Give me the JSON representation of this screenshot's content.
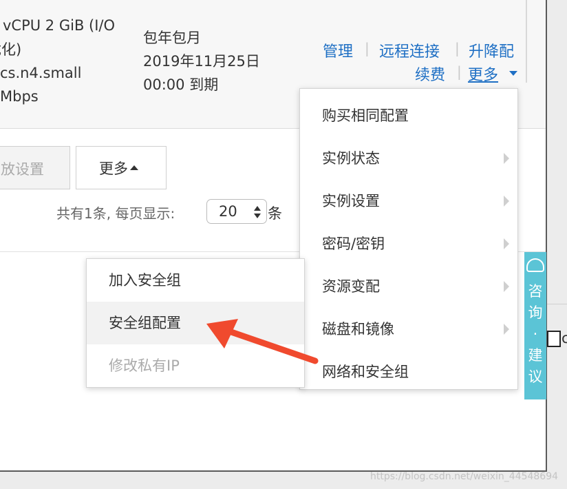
{
  "instance": {
    "spec_lines": [
      "vCPU 2 GiB (I/O",
      "优化)",
      "cs.n4.small",
      "Mbps"
    ],
    "billing_lines": [
      "包年包月",
      "2019年11月25日",
      "00:00 到期"
    ]
  },
  "operations": {
    "manage": "管理",
    "remote_connect": "远程连接",
    "upgrade": "升降配",
    "renew": "续费",
    "more": "更多",
    "separator": "|"
  },
  "toolbar": {
    "release_settings": "放设置",
    "more": "更多"
  },
  "pager": {
    "summary": "共有1条, 每页显示:",
    "page_size": "20",
    "unit": "条"
  },
  "more_menu": {
    "items": [
      {
        "label": "购买相同配置",
        "submenu": false
      },
      {
        "label": "实例状态",
        "submenu": true
      },
      {
        "label": "实例设置",
        "submenu": true
      },
      {
        "label": "密码/密钥",
        "submenu": true
      },
      {
        "label": "资源变配",
        "submenu": true
      },
      {
        "label": "磁盘和镜像",
        "submenu": true
      },
      {
        "label": "网络和安全组",
        "submenu": true
      }
    ]
  },
  "network_submenu": {
    "items": [
      {
        "label": "加入安全组",
        "state": "normal"
      },
      {
        "label": "安全组配置",
        "state": "highlighted"
      },
      {
        "label": "修改私有IP",
        "state": "disabled"
      }
    ]
  },
  "float_button": {
    "label": "咨询·建议",
    "chars": [
      "咨",
      "询",
      "·",
      "建",
      "议"
    ]
  },
  "partial_text": "c",
  "watermark": "https://blog.csdn.net/weixin_44548694",
  "colors": {
    "link": "#1e6fc4",
    "arrow": "#f04a2e",
    "float_bg": "#5bc4d6"
  }
}
